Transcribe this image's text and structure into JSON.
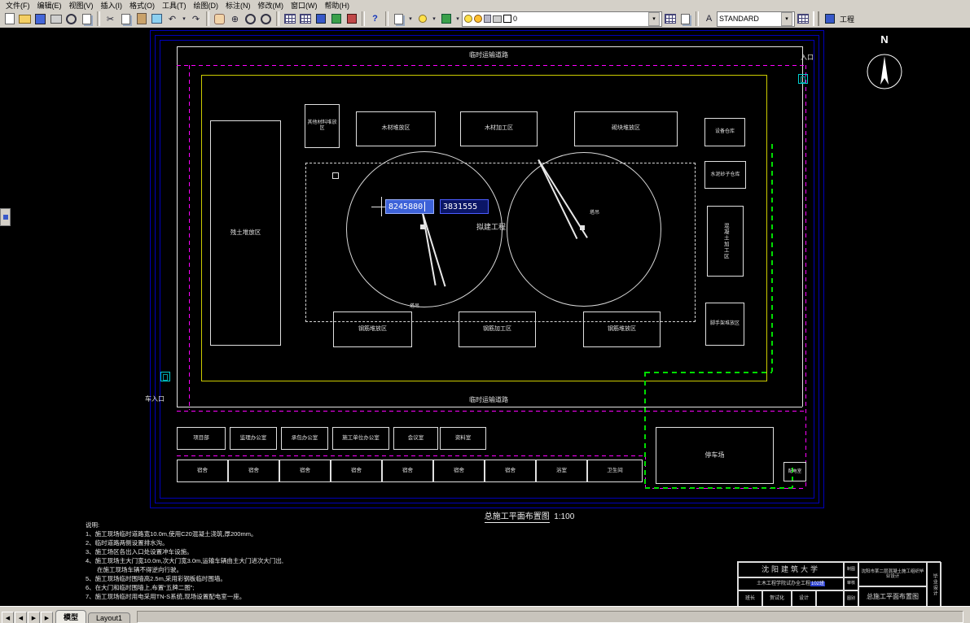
{
  "menubar": {
    "items": [
      "文件(F)",
      "编辑(E)",
      "视图(V)",
      "插入(I)",
      "格式(O)",
      "工具(T)",
      "绘图(D)",
      "标注(N)",
      "修改(M)",
      "窗口(W)",
      "帮助(H)"
    ]
  },
  "toolbar": {
    "layer_value": "0",
    "style_value": "STANDARD",
    "right_toolbar_label": "工程",
    "help_glyph": "?",
    "dropdown_glyph": "▾",
    "cut_glyph": "✂",
    "undo_glyph": "↶",
    "redo_glyph": "↷",
    "zoom_glyph": "⊕",
    "text_style_glyph": "A"
  },
  "statusbar": {
    "tabs": [
      "模型",
      "Layout1"
    ],
    "nav_first": "◀",
    "nav_prev": "◀",
    "nav_next": "▶",
    "nav_last": "▶"
  },
  "drawing": {
    "north": "N",
    "road_top": "临时运输道路",
    "road_bottom": "临时运输道路",
    "entrance_top": "入口",
    "entrance_bottom": "车入口",
    "coord_x": "8245880",
    "coord_y": "3831555",
    "building": "拟建工程",
    "crane": "塔吊",
    "zones": {
      "soil": "残土堆放区",
      "other": "其他材料堆放区",
      "wood_storage": "木材堆放区",
      "wood_process": "木材加工区",
      "block": "砌块堆放区",
      "equipment": "设备仓库",
      "cement": "水泥砂子仓库",
      "concrete": "混凝土加工区",
      "scaffold": "脚手架堆放区",
      "rebar_storage_1": "钢筋堆放区",
      "rebar_process": "钢筋加工区",
      "rebar_storage_2": "钢筋堆放区"
    },
    "offices": [
      "项目部",
      "监理办公室",
      "承包办公室",
      "施工单位办公室",
      "会议室",
      "资料室"
    ],
    "dorms": [
      "宿舍",
      "宿舍",
      "宿舍",
      "宿舍",
      "宿舍",
      "宿舍",
      "宿舍",
      "浴室",
      "卫生间"
    ],
    "parking": "停车场",
    "power_room": "配电室",
    "title": "总施工平面布置图",
    "title_scale": "1:100",
    "notes_heading": "说明:",
    "notes": [
      "1、施工现场临时道路宽10.0m,使用C20混凝土浇筑,厚200mm。",
      "2、临时道路两侧设置排水沟。",
      "3、施工场区各出入口处设置冲车设施。",
      "4、施工现场主大门宽10.0m,次大门宽3.0m,运输车辆由主大门进次大门出,",
      "在施工现场车辆不得逆向行驶。",
      "5、施工现场临时围墙高2.5m,采用彩钢板临时围墙。",
      "6、在大门和临时围墙上,布置“五牌二图”;",
      "7、施工现场临时用电采用TN-S系统,现场设置配电室一座。"
    ]
  },
  "titleblock": {
    "school": "沈阳建筑大学",
    "class_pre": "土木工程学院试办全工程",
    "class_hl": "102班",
    "cell_1": "班长",
    "cell_2": "贺试化",
    "cell_3": "设计",
    "col_label_1": "制图",
    "col_label_2": "审核",
    "col_label_3": "图别",
    "project": "沈阳市某二层混凝土施工组织毕业设计",
    "stage": "毕业设计",
    "drawing_name": "总施工平面布置图"
  },
  "colors": {
    "fence": "#ff00ff",
    "power_line": "#00dd00",
    "site_boundary": "#cccc00",
    "sheet_frame": "#0000bb",
    "highlight": "#2a3fd0"
  }
}
